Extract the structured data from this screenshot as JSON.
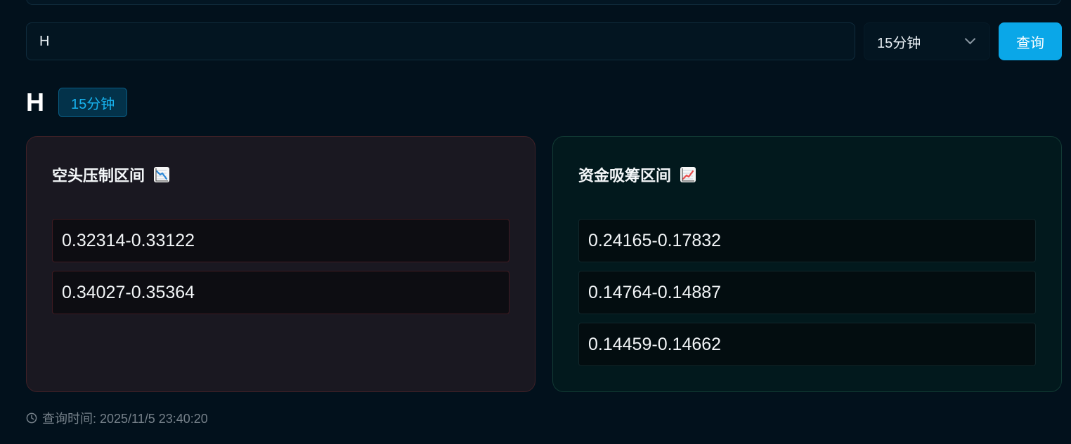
{
  "search": {
    "value": "H",
    "interval_value": "15分钟",
    "query_label": "查询"
  },
  "result": {
    "symbol": "H",
    "interval_badge": "15分钟"
  },
  "panels": {
    "bearish": {
      "title": "空头压制区间",
      "icon": "chart-decreasing-icon",
      "ranges": [
        "0.32314-0.33122",
        "0.34027-0.35364"
      ]
    },
    "bullish": {
      "title": "资金吸筹区间",
      "icon": "chart-increasing-icon",
      "ranges": [
        "0.24165-0.17832",
        "0.14764-0.14887",
        "0.14459-0.14662"
      ]
    }
  },
  "footer": {
    "query_time": "查询时间: 2025/11/5 23:40:20"
  },
  "colors": {
    "accent": "#0aa7e8",
    "bearish_border": "#402127",
    "bullish_border": "#123a34"
  }
}
